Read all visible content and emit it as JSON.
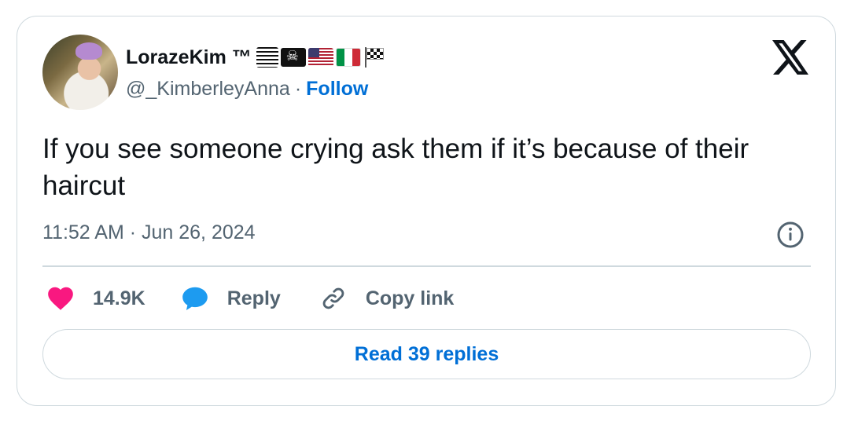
{
  "author": {
    "display_name": "LorazeKim ™",
    "handle": "@_KimberleyAnna",
    "separator": "·",
    "follow_label": "Follow",
    "flags": [
      "lines-flag",
      "pirate-flag",
      "us-flag",
      "italy-flag",
      "checkered-flag"
    ]
  },
  "tweet": {
    "text": "If you see someone crying ask them if it’s because of their haircut",
    "timestamp": "11:52 AM · Jun 26, 2024"
  },
  "actions": {
    "like_count": "14.9K",
    "reply_label": "Reply",
    "copy_link_label": "Copy link"
  },
  "read_replies_label": "Read 39 replies",
  "colors": {
    "link_blue": "#006fd6",
    "heart_pink": "#f91880",
    "reply_blue": "#1d9bf0",
    "secondary_text": "#536471",
    "border": "#cfd9de"
  },
  "icons": {
    "logo": "x-logo-icon",
    "info": "info-icon",
    "like": "heart-icon",
    "reply": "speech-bubble-icon",
    "copy": "link-icon"
  }
}
